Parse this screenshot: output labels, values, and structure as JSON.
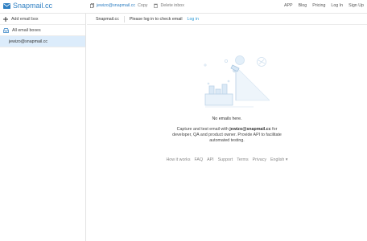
{
  "brand": {
    "name": "Snapmail.cc"
  },
  "header": {
    "email": "jewizo@snapmail.cc",
    "copy_label": "Copy",
    "delete_label": "Delete inbox",
    "nav": [
      "APP",
      "Blog",
      "Pricing",
      "Log In",
      "Sign Up"
    ]
  },
  "sidebar": {
    "add_label": "Add email box",
    "all_label": "All email boxes",
    "active_email": "jewizo@snapmail.cc"
  },
  "main": {
    "breadcrumb_domain": "Snapmail.cc",
    "login_prompt": "Please log in to check email",
    "login_link": "Log in",
    "empty_title": "No emails here.",
    "desc_prefix": "Capture and test email with",
    "desc_email": "jewizo@snapmail.cc",
    "desc_suffix": "for developer, QA and product owner. Provide API to facilitate automated testing."
  },
  "footer": {
    "links": [
      "How it works",
      "FAQ",
      "API",
      "Support",
      "Terms",
      "Privacy"
    ],
    "language": "English"
  },
  "colors": {
    "accent": "#2e7fc2",
    "link": "#2e9ad6",
    "selected_bg": "#dcecfb"
  }
}
